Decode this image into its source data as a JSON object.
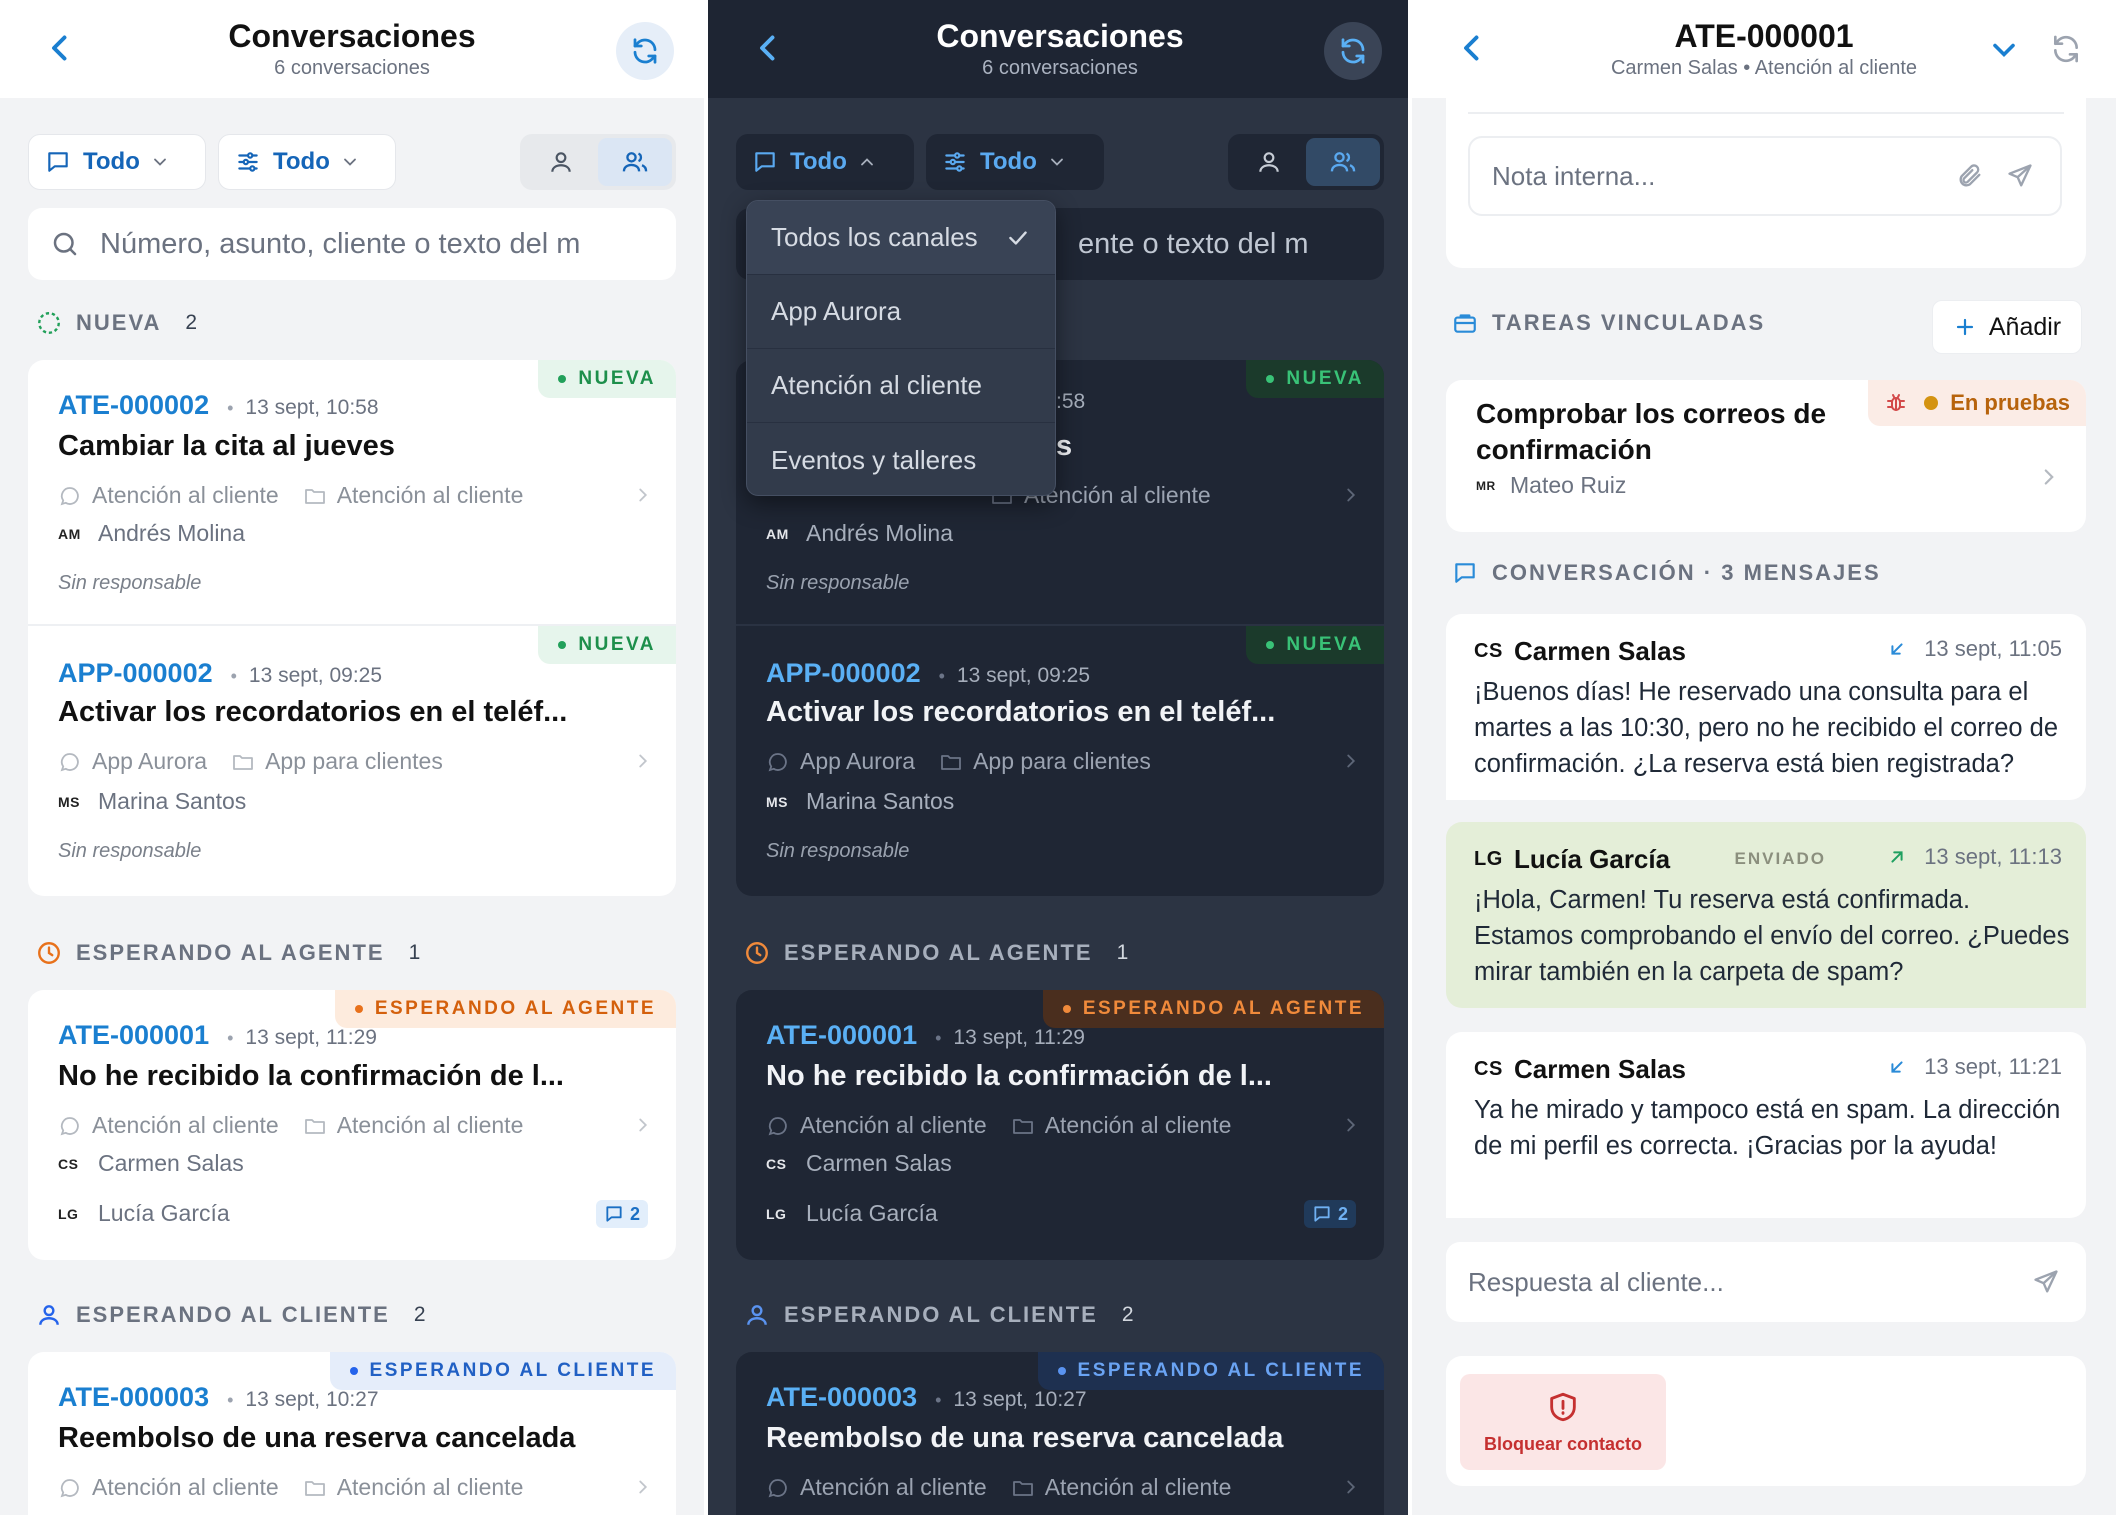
{
  "list": {
    "title": "Conversaciones",
    "subtitle": "6 conversaciones",
    "filter_channel": "Todo",
    "filter_more": "Todo",
    "search_placeholder": "Número, asunto, cliente o texto del m",
    "sections": {
      "nueva": {
        "label": "NUEVA",
        "count": "2"
      },
      "agente": {
        "label": "ESPERANDO AL AGENTE",
        "count": "1"
      },
      "cliente": {
        "label": "ESPERANDO AL CLIENTE",
        "count": "2"
      }
    },
    "tickets": [
      {
        "id": "ATE-000002",
        "time": "13 sept, 10:58",
        "subject": "Cambiar la cita al jueves",
        "channel": "Atención al cliente",
        "queue": "Atención al cliente",
        "initials": "AM",
        "customer": "Andrés Molina",
        "assignee": "Sin responsable",
        "badge": "NUEVA"
      },
      {
        "id": "APP-000002",
        "time": "13 sept, 09:25",
        "subject": "Activar los recordatorios en el teléf...",
        "channel": "App Aurora",
        "queue": "App para clientes",
        "initials": "MS",
        "customer": "Marina Santos",
        "assignee": "Sin responsable",
        "badge": "NUEVA"
      },
      {
        "id": "ATE-000001",
        "time": "13 sept, 11:29",
        "subject": "No he recibido la confirmación de l...",
        "channel": "Atención al cliente",
        "queue": "Atención al cliente",
        "initials": "CS",
        "customer": "Carmen Salas",
        "agent_initials": "LG",
        "agent": "Lucía García",
        "messages": "2",
        "badge": "ESPERANDO AL AGENTE"
      },
      {
        "id": "ATE-000003",
        "time": "13 sept, 10:27",
        "subject": "Reembolso de una reserva cancelada",
        "channel": "Atención al cliente",
        "queue": "Atención al cliente",
        "badge": "ESPERANDO AL CLIENTE"
      }
    ]
  },
  "dark": {
    "dropdown": {
      "options": [
        "Todos los canales",
        "App Aurora",
        "Atención al cliente",
        "Eventos y talleres"
      ],
      "selected": "Todos los canales"
    },
    "search_visible": "ente o texto del m",
    "card1_time_fragment": ":58",
    "card1_subject_fragment": "s",
    "card1_channel_fragment": "Atención al cliente"
  },
  "detail": {
    "title": "ATE-000001",
    "subtitle": "Carmen Salas • Atención al cliente",
    "note_placeholder": "Nota interna...",
    "tasks_label": "TAREAS VINCULADAS",
    "add_label": "Añadir",
    "task": {
      "title": "Comprobar los correos de confirmación",
      "status": "En pruebas",
      "initials": "MR",
      "assignee": "Mateo Ruiz"
    },
    "conversation_label": "CONVERSACIÓN · 3 MENSAJES",
    "messages": [
      {
        "initials": "CS",
        "author": "Carmen Salas",
        "time": "13 sept, 11:05",
        "text": "¡Buenos días! He reservado una consulta para el martes a las 10:30, pero no he recibido el correo de confirmación. ¿La reserva está bien registrada?"
      },
      {
        "initials": "LG",
        "author": "Lucía García",
        "status": "ENVIADO",
        "time": "13 sept, 11:13",
        "text": "¡Hola, Carmen! Tu reserva está confirmada. Estamos comprobando el envío del correo. ¿Puedes mirar también en la carpeta de spam?"
      },
      {
        "initials": "CS",
        "author": "Carmen Salas",
        "time": "13 sept, 11:21",
        "text": "Ya he mirado y tampoco está en spam. La dirección de mi perfil es correcta. ¡Gracias por la ayuda!"
      }
    ],
    "reply_placeholder": "Respuesta al cliente...",
    "block_label": "Bloquear contacto"
  },
  "colors": {
    "accent": "#1a7fd0",
    "new": "#1d8f4b",
    "agent": "#d4600c",
    "client": "#2160c4",
    "sent_bubble": "#e4eed8"
  }
}
